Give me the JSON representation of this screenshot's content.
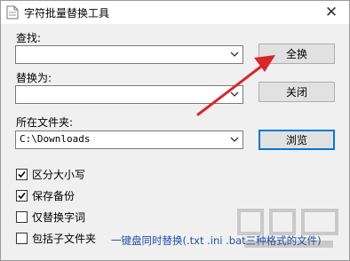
{
  "window": {
    "title": "字符批量替换工具"
  },
  "find": {
    "label": "查找:",
    "value": ""
  },
  "replace": {
    "label": "替换为:",
    "value": ""
  },
  "folder": {
    "label": "所在文件夹:",
    "value": "C:\\Downloads"
  },
  "buttons": {
    "replace_all": "全换",
    "close": "关闭",
    "browse": "浏览"
  },
  "options": [
    {
      "label": "区分大小写",
      "checked": true
    },
    {
      "label": "保存备份",
      "checked": true
    },
    {
      "label": "仅替换字词",
      "checked": false
    },
    {
      "label": "包括子文件夹",
      "checked": false
    }
  ],
  "note": "一键盘同时替换(.txt .ini .bat三种格式的文件)",
  "colors": {
    "annotation_arrow": "#d9262b",
    "note_text": "#1f4fa8",
    "focus_border": "#0078d7"
  }
}
